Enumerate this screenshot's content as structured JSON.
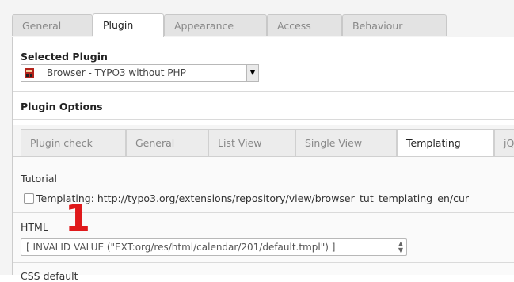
{
  "top_tabs": [
    {
      "label": "General",
      "active": false
    },
    {
      "label": "Plugin",
      "active": true
    },
    {
      "label": "Appearance",
      "active": false
    },
    {
      "label": "Access",
      "active": false
    },
    {
      "label": "Behaviour",
      "active": false
    }
  ],
  "selected_plugin": {
    "heading": "Selected Plugin",
    "value": "Browser - TYPO3 without PHP",
    "icon": "plugin-icon"
  },
  "plugin_options": {
    "heading": "Plugin Options",
    "tabs": [
      {
        "label": "Plugin check",
        "active": false
      },
      {
        "label": "General",
        "active": false
      },
      {
        "label": "List View",
        "active": false
      },
      {
        "label": "Single View",
        "active": false
      },
      {
        "label": "Templating",
        "active": true
      },
      {
        "label": "jQ",
        "active": false
      }
    ]
  },
  "tutorial": {
    "label": "Tutorial",
    "checkbox_text": "Templating: http://typo3.org/extensions/repository/view/browser_tut_templating_en/cur",
    "checked": false
  },
  "annotation_marker": "1",
  "html_field": {
    "label": "HTML",
    "value": "[ INVALID VALUE (\"EXT:org/res/html/calendar/201/default.tmpl\") ]"
  },
  "css_field": {
    "label": "CSS default"
  },
  "colors": {
    "marker": "#e0191b",
    "tab_active_bg": "#ffffff",
    "tab_inactive_bg": "#e3e3e3"
  }
}
